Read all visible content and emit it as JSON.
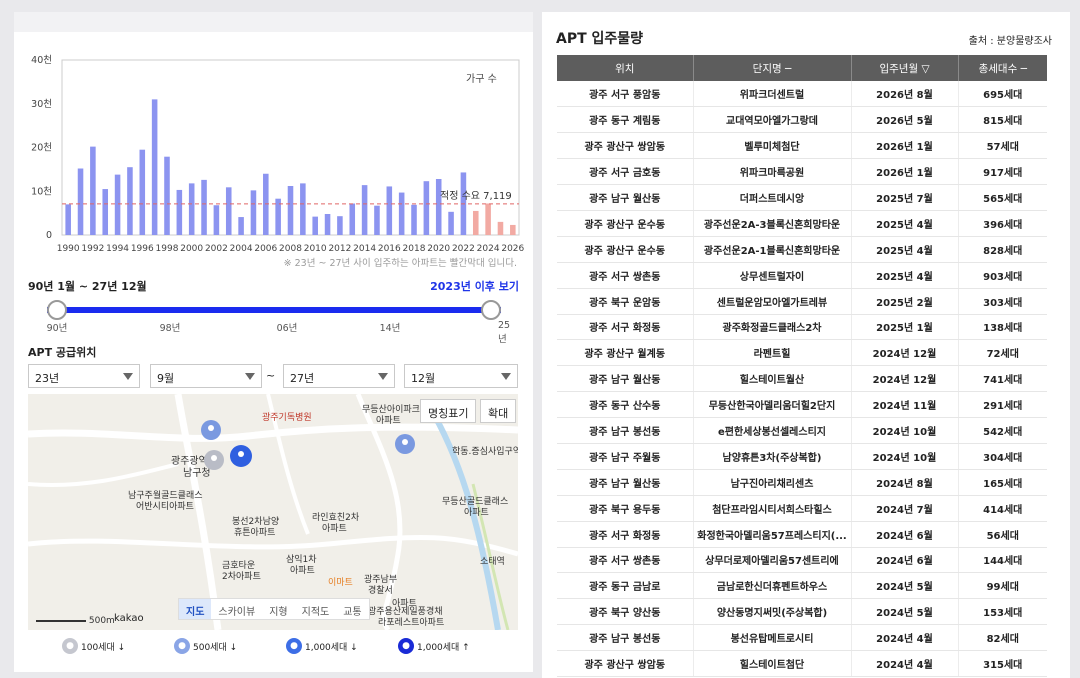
{
  "chart_data": {
    "type": "bar",
    "categories": [
      "1990",
      "1991",
      "1992",
      "1993",
      "1994",
      "1995",
      "1996",
      "1997",
      "1998",
      "1999",
      "2000",
      "2001",
      "2002",
      "2003",
      "2004",
      "2005",
      "2006",
      "2007",
      "2008",
      "2009",
      "2010",
      "2011",
      "2012",
      "2013",
      "2014",
      "2015",
      "2016",
      "2017",
      "2018",
      "2019",
      "2020",
      "2021",
      "2022",
      "2023",
      "2024",
      "2025",
      "2026"
    ],
    "values": [
      7000,
      15200,
      20200,
      10500,
      13800,
      15500,
      19500,
      31000,
      17900,
      10300,
      11800,
      12600,
      6800,
      10900,
      4100,
      10200,
      14000,
      8300,
      11200,
      11800,
      4200,
      4800,
      4300,
      7200,
      11400,
      6700,
      11100,
      9700,
      6900,
      12300,
      12800,
      5300,
      14300,
      5500,
      7200,
      3000,
      2300
    ],
    "projected_from": "2023",
    "title": "가구 수",
    "xtick_labels": [
      "1990",
      "1992",
      "1994",
      "1996",
      "1998",
      "2000",
      "2002",
      "2004",
      "2006",
      "2008",
      "2010",
      "2012",
      "2014",
      "2016",
      "2018",
      "2020",
      "2022",
      "2024",
      "2026"
    ],
    "yticks": [
      "0",
      "10천",
      "20천",
      "30천",
      "40천"
    ],
    "ylim": [
      0,
      40000
    ],
    "reference_line": {
      "label": "적정 수요 7,119",
      "value": 7119
    },
    "colors": {
      "past": "#8c94f0",
      "future": "#f2aaa3",
      "ref": "#e06666"
    }
  },
  "chart_note": "※ 23년 ~ 27년 사이 입주하는 아파트는 빨간막대 입니다.",
  "range": {
    "label": "90년 1월 ~ 27년 12월",
    "link": "2023년 이후 보기",
    "start_frac": 0,
    "end_frac": 1,
    "ticks": [
      "90년",
      "98년",
      "06년",
      "14년",
      "25년"
    ]
  },
  "supply": {
    "title": "APT 공급위치",
    "selects": [
      "23년",
      "9월",
      "27년",
      "12월"
    ],
    "tilde": "~"
  },
  "map": {
    "btn_names": "명칭표기",
    "btn_zoom": "확대",
    "tabs": [
      "지도",
      "스카이뷰",
      "지형",
      "지적도",
      "교통"
    ],
    "active_tab": "지도",
    "scale": "500m",
    "brand": "kakao",
    "labels": [
      "광주기독병원",
      "무등산아이파크",
      "아파트",
      "학동.증심사입구역",
      "광주광역시",
      "남구청",
      "남구주월골드클래스",
      "어반시티아파트",
      "무등산골드클래스",
      "아파트",
      "라인효친2차",
      "아파트",
      "봉선2차남양",
      "휴튼아파트",
      "삼익1차",
      "아파트",
      "금호타운",
      "2차아파트",
      "이마트",
      "광주남부",
      "경찰서",
      "소태역",
      "광주용산제일풍경채",
      "아파트",
      "라포레스트아파트"
    ]
  },
  "legend": [
    "100세대 ↓",
    "500세대 ↓",
    "1,000세대 ↓",
    "1,000세대 ↑"
  ],
  "table": {
    "title": "APT 입주물량",
    "source": "출처 : 분양물량조사",
    "headers": [
      "위치",
      "단지명 ─",
      "입주년월 ▽",
      "총세대수 ─"
    ],
    "rows": [
      [
        "광주 서구 풍암동",
        "위파크더센트럴",
        "2026년 8월",
        "695세대"
      ],
      [
        "광주 동구 계림동",
        "교대역모아엘가그랑데",
        "2026년 5월",
        "815세대"
      ],
      [
        "광주 광산구 쌍암동",
        "벨루미체첨단",
        "2026년 1월",
        "57세대"
      ],
      [
        "광주 서구 금호동",
        "위파크마륵공원",
        "2026년 1월",
        "917세대"
      ],
      [
        "광주 남구 월산동",
        "더퍼스트데시앙",
        "2025년 7월",
        "565세대"
      ],
      [
        "광주 광산구 운수동",
        "광주선운2A-3블록신혼희망타운",
        "2025년 4월",
        "396세대"
      ],
      [
        "광주 광산구 운수동",
        "광주선운2A-1블록신혼희망타운",
        "2025년 4월",
        "828세대"
      ],
      [
        "광주 서구 쌍촌동",
        "상무센트럴자이",
        "2025년 4월",
        "903세대"
      ],
      [
        "광주 북구 운암동",
        "센트럴운암모아엘가트레뷰",
        "2025년 2월",
        "303세대"
      ],
      [
        "광주 서구 화정동",
        "광주화정골드클래스2차",
        "2025년 1월",
        "138세대"
      ],
      [
        "광주 광산구 월계동",
        "라펜트힐",
        "2024년 12월",
        "72세대"
      ],
      [
        "광주 남구 월산동",
        "힐스테이트월산",
        "2024년 12월",
        "741세대"
      ],
      [
        "광주 동구 산수동",
        "무등산한국아델리움더힐2단지",
        "2024년 11월",
        "291세대"
      ],
      [
        "광주 남구 봉선동",
        "e편한세상봉선셀레스티지",
        "2024년 10월",
        "542세대"
      ],
      [
        "광주 남구 주월동",
        "남양휴튼3차(주상복합)",
        "2024년 10월",
        "304세대"
      ],
      [
        "광주 남구 월산동",
        "남구진아리채리센츠",
        "2024년 8월",
        "165세대"
      ],
      [
        "광주 북구 용두동",
        "첨단프라임시티서희스타힐스",
        "2024년 7월",
        "414세대"
      ],
      [
        "광주 서구 화정동",
        "화정한국아델리움57프레스티지(...",
        "2024년 6월",
        "56세대"
      ],
      [
        "광주 서구 쌍촌동",
        "상무더로제아델리움57센트리에",
        "2024년 6월",
        "144세대"
      ],
      [
        "광주 동구 금남로",
        "금남로한신더휴펜트하우스",
        "2024년 5월",
        "99세대"
      ],
      [
        "광주 북구 양산동",
        "양산동명지써밋(주상복합)",
        "2024년 5월",
        "153세대"
      ],
      [
        "광주 남구 봉선동",
        "봉선유탑메트로시티",
        "2024년 4월",
        "82세대"
      ],
      [
        "광주 광산구 쌍암동",
        "힐스테이트첨단",
        "2024년 4월",
        "315세대"
      ]
    ]
  }
}
